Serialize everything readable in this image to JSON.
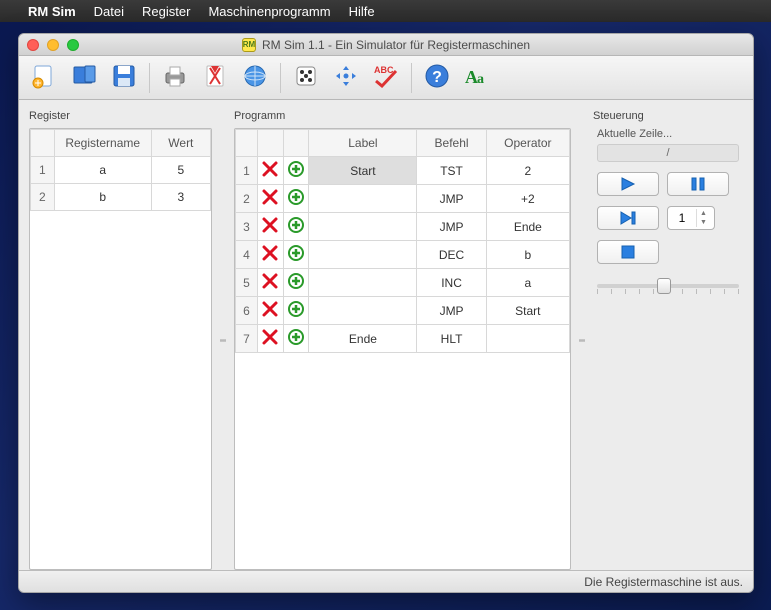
{
  "menubar": {
    "app": "RM Sim",
    "items": [
      "Datei",
      "Register",
      "Maschinenprogramm",
      "Hilfe"
    ]
  },
  "window": {
    "title": "RM Sim 1.1 - Ein Simulator für Registermaschinen",
    "app_badge": "RM"
  },
  "toolbar": {
    "items": [
      {
        "name": "new-icon"
      },
      {
        "name": "open-icon"
      },
      {
        "name": "save-icon"
      },
      {
        "sep": true
      },
      {
        "name": "print-icon"
      },
      {
        "name": "pdf-icon"
      },
      {
        "name": "web-icon"
      },
      {
        "sep": true
      },
      {
        "name": "dice-icon"
      },
      {
        "name": "arrows-icon"
      },
      {
        "name": "check-abc-icon"
      },
      {
        "sep": true
      },
      {
        "name": "help-icon"
      },
      {
        "name": "font-icon"
      }
    ]
  },
  "register": {
    "title": "Register",
    "headers": {
      "name": "Registername",
      "value": "Wert"
    },
    "rows": [
      {
        "i": "1",
        "name": "a",
        "value": "5"
      },
      {
        "i": "2",
        "name": "b",
        "value": "3"
      }
    ]
  },
  "program": {
    "title": "Programm",
    "headers": {
      "label": "Label",
      "befehl": "Befehl",
      "operator": "Operator"
    },
    "rows": [
      {
        "i": "1",
        "label": "Start",
        "befehl": "TST",
        "operator": "2",
        "hl": true
      },
      {
        "i": "2",
        "label": "",
        "befehl": "JMP",
        "operator": "+2"
      },
      {
        "i": "3",
        "label": "",
        "befehl": "JMP",
        "operator": "Ende"
      },
      {
        "i": "4",
        "label": "",
        "befehl": "DEC",
        "operator": "b"
      },
      {
        "i": "5",
        "label": "",
        "befehl": "INC",
        "operator": "a"
      },
      {
        "i": "6",
        "label": "",
        "befehl": "JMP",
        "operator": "Start"
      },
      {
        "i": "7",
        "label": "Ende",
        "befehl": "HLT",
        "operator": ""
      }
    ]
  },
  "control": {
    "title": "Steuerung",
    "current_line_label": "Aktuelle Zeile...",
    "current_line_value": "/",
    "step_value": "1"
  },
  "status": "Die Registermaschine ist aus."
}
